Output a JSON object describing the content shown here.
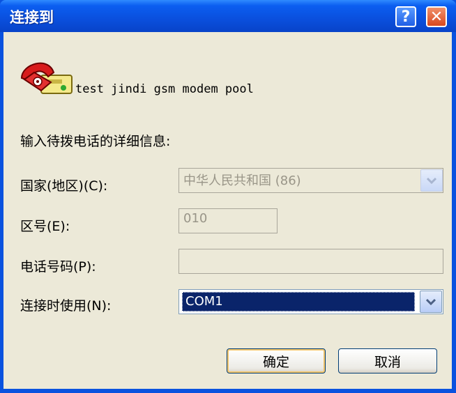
{
  "window": {
    "title": "连接到",
    "help_label": "?",
    "close_label": "✕"
  },
  "connection": {
    "name": "test jindi gsm modem pool"
  },
  "form": {
    "instruction": "输入待拨电话的详细信息:",
    "country_label": "国家(地区)(C):",
    "country_value": "中华人民共和国 (86)",
    "area_label": "区号(E):",
    "area_value": "010",
    "phone_label": "电话号码(P):",
    "phone_value": "",
    "connect_using_label": "连接时使用(N):",
    "connect_using_value": "COM1"
  },
  "buttons": {
    "ok": "确定",
    "cancel": "取消"
  },
  "icons": {
    "phone": "telephone-modem-icon",
    "dropdown": "chevron-down-icon"
  },
  "colors": {
    "titlebar": "#0A4FDD",
    "client": "#ECE9D8",
    "selection": "#0A246A"
  }
}
